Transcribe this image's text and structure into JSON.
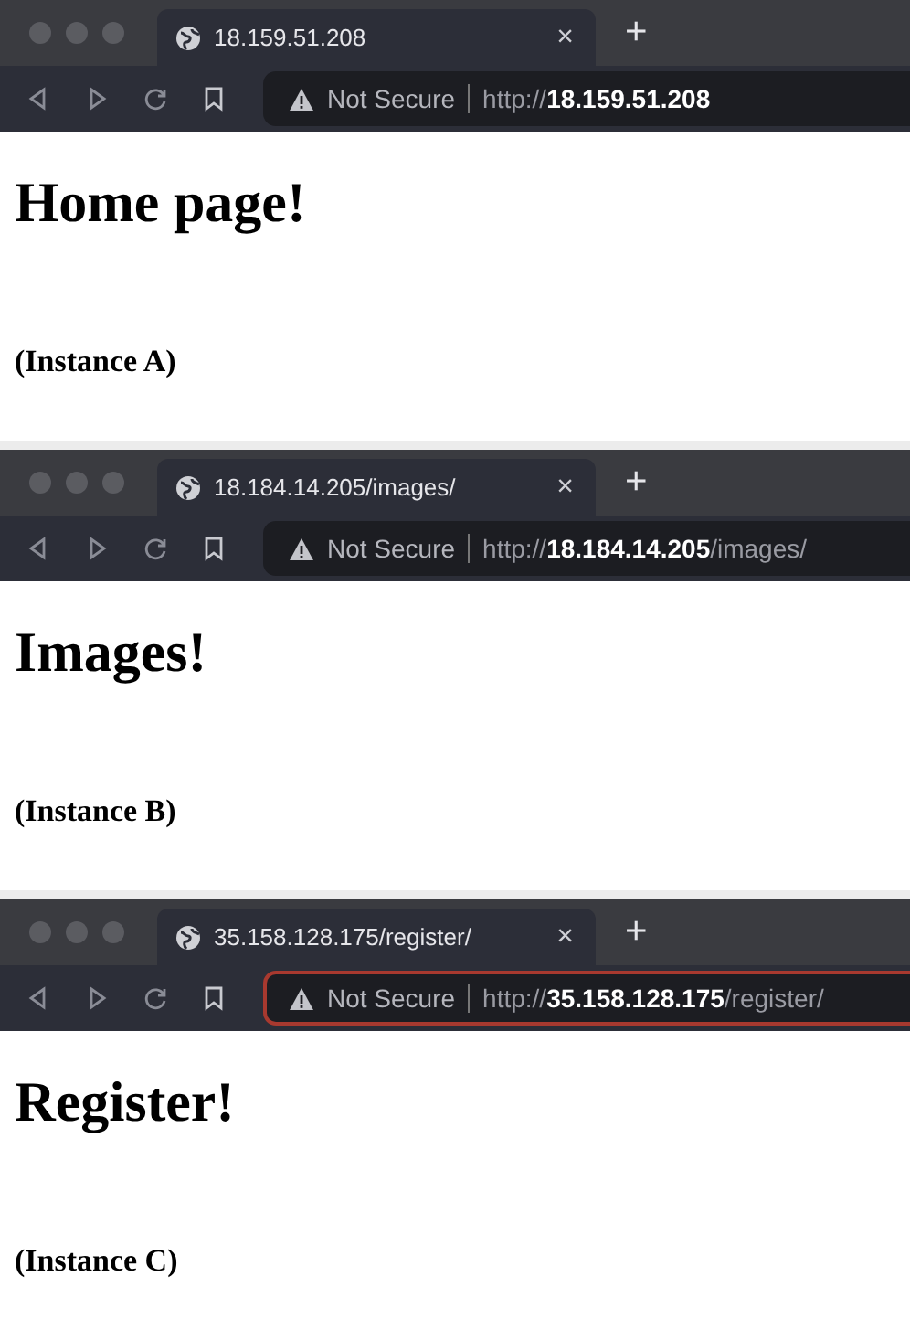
{
  "windows": [
    {
      "tab": {
        "title": "18.159.51.208",
        "close": "×"
      },
      "new_tab": "+",
      "address": {
        "security": "Not Secure",
        "scheme": "http://",
        "host": "18.159.51.208",
        "focused": false
      },
      "page": {
        "heading": "Home page!",
        "note": "(Instance A)"
      }
    },
    {
      "tab": {
        "title": "18.184.14.205/images/",
        "close": "×"
      },
      "new_tab": "+",
      "address": {
        "security": "Not Secure",
        "scheme": "http://",
        "host": "18.184.14.205",
        "path": "/images/",
        "focused": false
      },
      "page": {
        "heading": "Images!",
        "note": "(Instance B)"
      }
    },
    {
      "tab": {
        "title": "35.158.128.175/register/",
        "close": "×"
      },
      "new_tab": "+",
      "address": {
        "security": "Not Secure",
        "scheme": "http://",
        "host": "35.158.128.175",
        "path": "/register/",
        "focused": true
      },
      "page": {
        "heading": "Register!",
        "note": "(Instance C)"
      }
    }
  ]
}
